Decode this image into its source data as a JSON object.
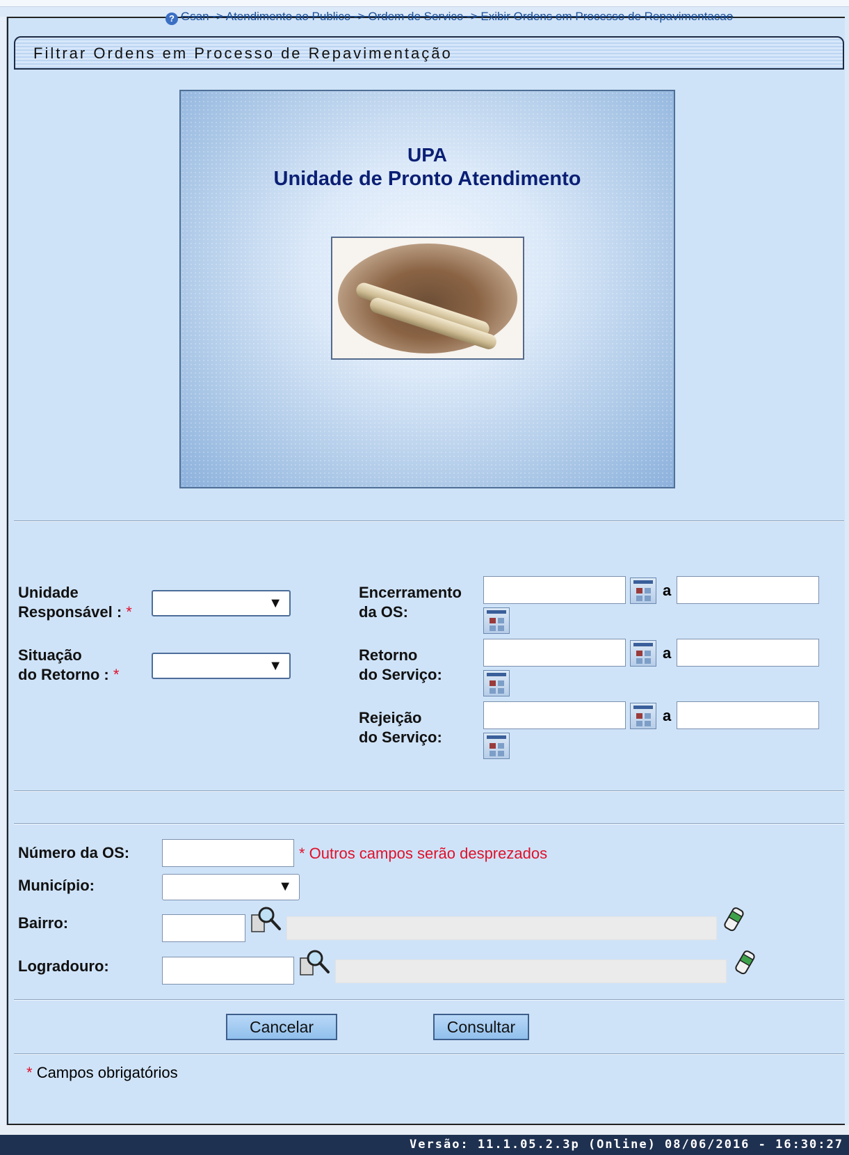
{
  "breadcrumb": {
    "help_glyph": "?",
    "text": "Gsan -> Atendimento ao Publico -> Ordem de Servico -> Exibir Ordens em Processo de Repavimentacao"
  },
  "header": {
    "title": "Filtrar Ordens em Processo de Repavimentação"
  },
  "banner": {
    "line1": "UPA",
    "line2": "Unidade de Pronto Atendimento"
  },
  "form": {
    "required_mark": "*",
    "range_sep": "a",
    "unidade_label_1": "Unidade",
    "unidade_label_2": "Responsável :",
    "situacao_label_1": "Situação",
    "situacao_label_2": "do Retorno :",
    "encerramento_label_1": "Encerramento",
    "encerramento_label_2": "da OS:",
    "retorno_label_1": "Retorno",
    "retorno_label_2": "do Serviço:",
    "rejeicao_label_1": "Rejeição",
    "rejeicao_label_2": "do Serviço:",
    "numero_label": "Número da OS:",
    "numero_warning": "* Outros campos serão desprezados",
    "municipio_label": "Município:",
    "bairro_label": "Bairro:",
    "logradouro_label": "Logradouro:",
    "select_arrow": "▼"
  },
  "buttons": {
    "cancel": "Cancelar",
    "submit": "Consultar"
  },
  "footnote": {
    "mark": "*",
    "text": "Campos obrigatórios"
  },
  "footer": {
    "version": "Versão: 11.1.05.2.3p (Online) 08/06/2016 - 16:30:27"
  }
}
